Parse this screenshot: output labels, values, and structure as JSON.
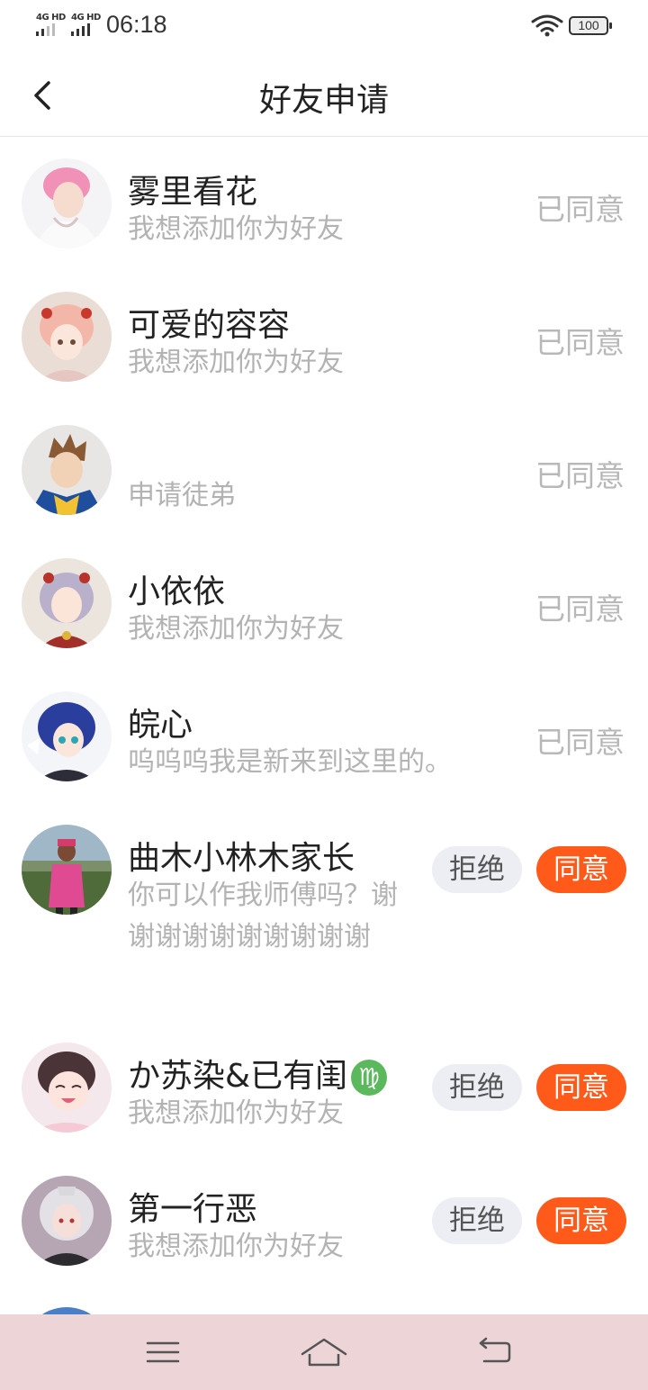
{
  "status_bar": {
    "net1": "4G HD",
    "net2": "4G HD",
    "time": "06:18",
    "battery": "100"
  },
  "header": {
    "title": "好友申请",
    "back_icon": "chevron-left-icon"
  },
  "requests": [
    {
      "name": "雾里看花",
      "message": "我想添加你为好友",
      "status": "已同意"
    },
    {
      "name": "可爱的容容",
      "message": "我想添加你为好友",
      "status": "已同意"
    },
    {
      "name": "",
      "message": "申请徒弟",
      "status": "已同意"
    },
    {
      "name": "小依依",
      "message": "我想添加你为好友",
      "status": "已同意"
    },
    {
      "name": "皖心",
      "message": "呜呜呜我是新来到这里的。",
      "status": "已同意"
    },
    {
      "name": "曲木小林木家长",
      "message": "你可以作我师傅吗？谢谢谢谢谢谢谢谢谢谢",
      "reject": "拒绝",
      "agree": "同意"
    },
    {
      "name": "か苏染&已有闺",
      "badge": "♍",
      "message": "我想添加你为好友",
      "reject": "拒绝",
      "agree": "同意"
    },
    {
      "name": "第一行恶",
      "message": "我想添加你为好友",
      "reject": "拒绝",
      "agree": "同意"
    }
  ],
  "colors": {
    "accent": "#ff5a1a",
    "reject_bg": "#eceef4",
    "muted": "#b3b3b3",
    "nav_bg": "#ecd4d7"
  },
  "nav_bar": {
    "menu_icon": "menu-icon",
    "home_icon": "home-icon",
    "back_icon": "back-arrow-icon"
  }
}
